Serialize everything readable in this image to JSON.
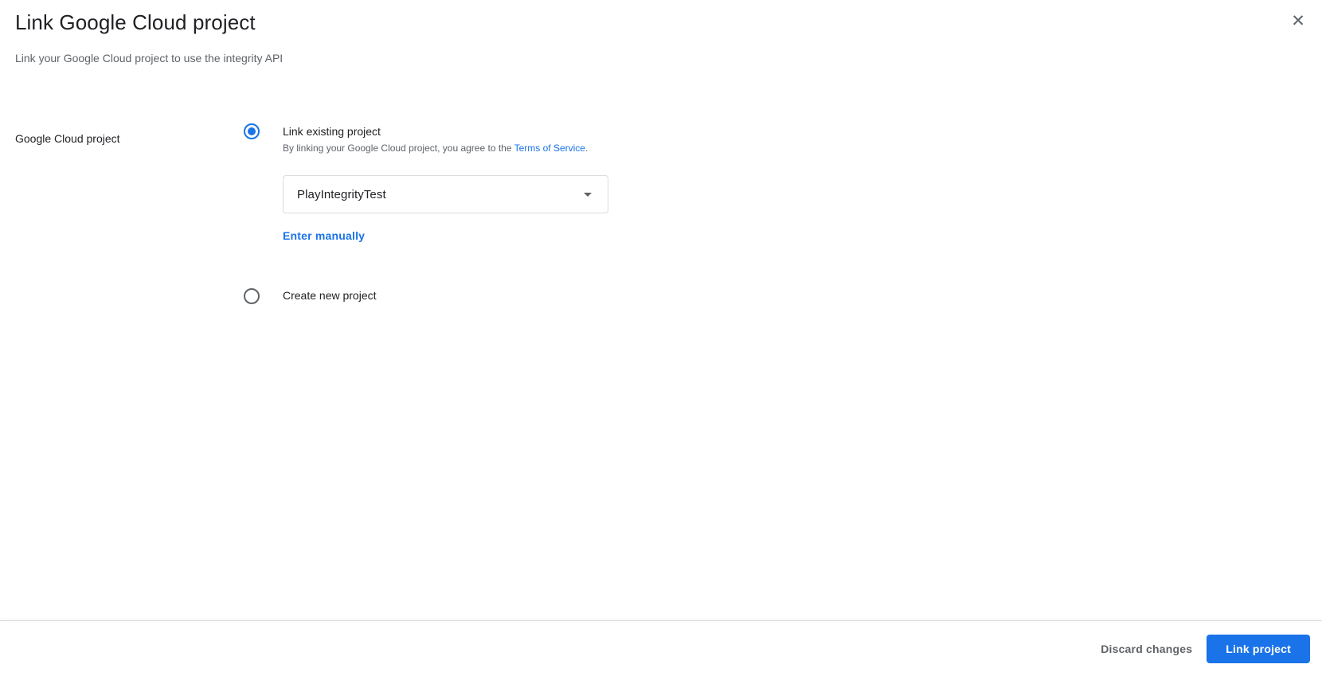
{
  "dialog": {
    "title": "Link Google Cloud project",
    "subtitle": "Link your Google Cloud project to use the integrity API"
  },
  "icons": {
    "close": "✕"
  },
  "form": {
    "row_label": "Google Cloud project",
    "options": [
      {
        "label": "Link existing project",
        "selected": true,
        "helper_prefix": "By linking your Google Cloud project, you agree to the ",
        "helper_link": "Terms of Service",
        "helper_suffix": "."
      },
      {
        "label": "Create new project",
        "selected": false
      }
    ],
    "project_select": {
      "value": "PlayIntegrityTest"
    },
    "enter_manually_label": "Enter manually"
  },
  "footer": {
    "discard_label": "Discard changes",
    "link_label": "Link project"
  },
  "colors": {
    "primary_blue": "#1a73e8",
    "text_primary": "#202124",
    "text_secondary": "#5f6368",
    "border": "#dadce0"
  }
}
